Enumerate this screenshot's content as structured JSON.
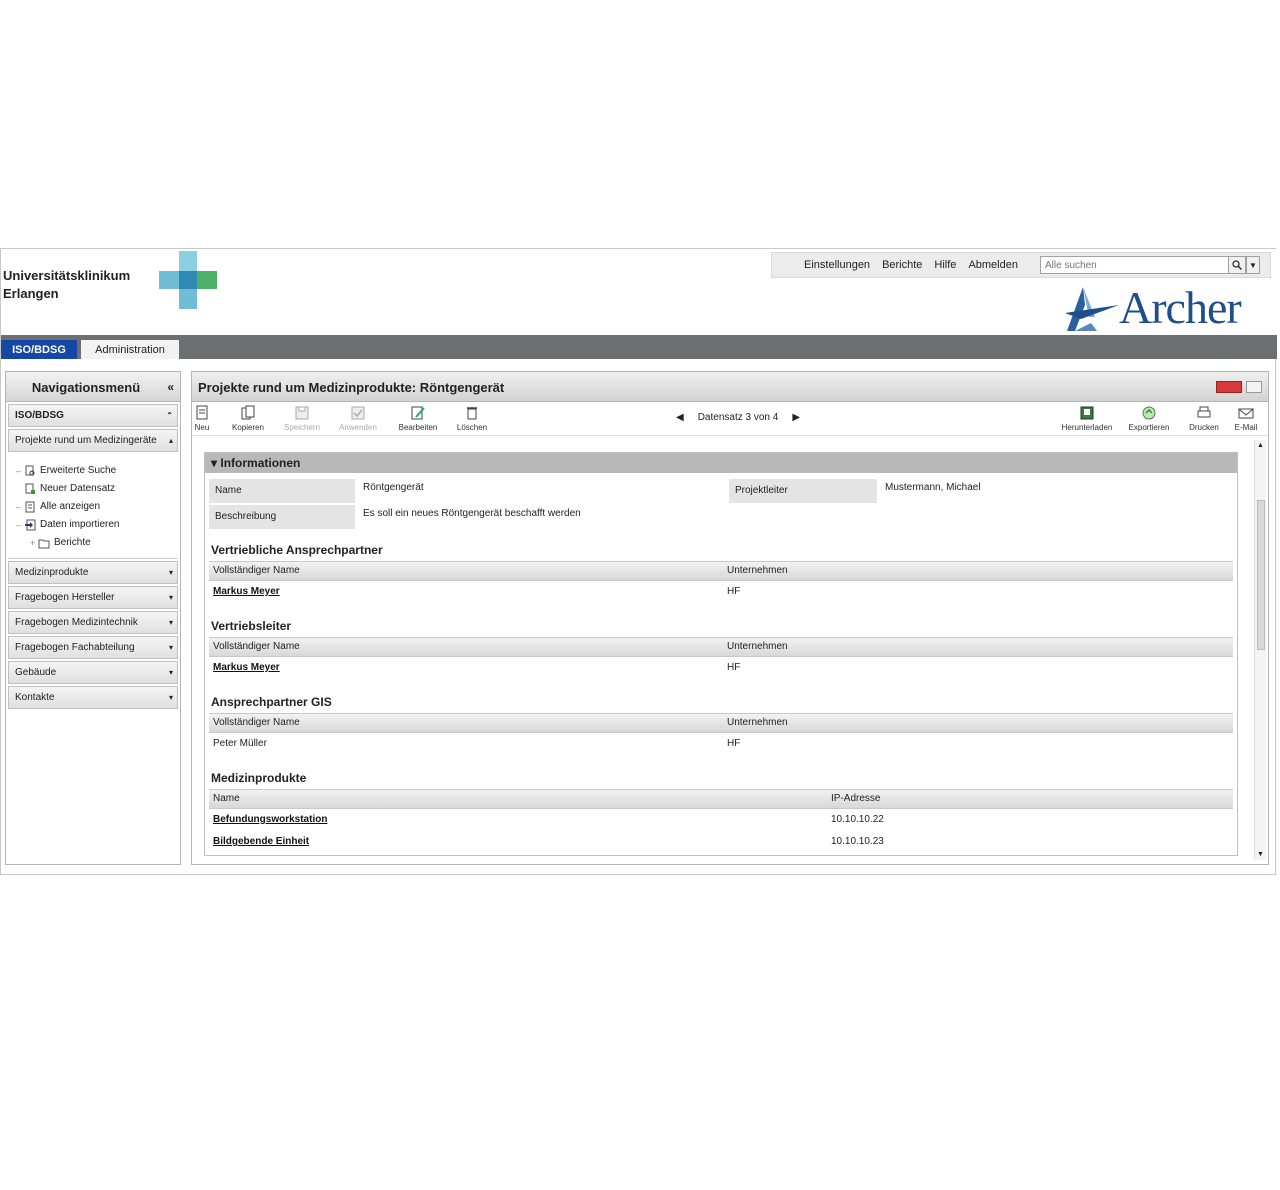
{
  "header": {
    "org_line1": "Universitätsklinikum",
    "org_line2": "Erlangen",
    "menu": [
      "Einstellungen",
      "Berichte",
      "Hilfe",
      "Abmelden"
    ],
    "search_placeholder": "Alle suchen",
    "brand": "Archer"
  },
  "tabs": [
    "ISO/BDSG",
    "Administration"
  ],
  "nav": {
    "title": "Navigationsmenü",
    "collapse": "«",
    "sections_top": [
      "ISO/BDSG",
      "Projekte rund um Medizingeräte"
    ],
    "tree": [
      "Erweiterte Suche",
      "Neuer Datensatz",
      "Alle anzeigen",
      "Daten importieren",
      "Berichte"
    ],
    "sections_bottom": [
      "Medizinprodukte",
      "Fragebogen Hersteller",
      "Fragebogen Medizintechnik",
      "Fragebogen Fachabteilung",
      "Gebäude",
      "Kontakte"
    ]
  },
  "main": {
    "title": "Projekte rund um Medizinprodukte: Röntgengerät",
    "toolbar_left": [
      "Neu",
      "Kopieren",
      "Speichern",
      "Anwenden",
      "Bearbeiten",
      "Löschen"
    ],
    "record_nav": "Datensatz 3 von 4",
    "toolbar_right": [
      "Herunterladen",
      "Exportieren",
      "Drucken",
      "E-Mail"
    ],
    "info": {
      "header": "Informationen",
      "name_label": "Name",
      "name_value": "Röntgengerät",
      "leader_label": "Projektleiter",
      "leader_value": "Mustermann, Michael",
      "desc_label": "Beschreibung",
      "desc_value": "Es soll ein neues Röntgengerät beschafft werden"
    },
    "vertrieb": {
      "title": "Vertriebliche Ansprechpartner",
      "col1": "Vollständiger Name",
      "col2": "Unternehmen",
      "row_name": "Markus Meyer",
      "row_company": "HF"
    },
    "vertriebsleiter": {
      "title": "Vertriebsleiter",
      "col1": "Vollständiger Name",
      "col2": "Unternehmen",
      "row_name": "Markus Meyer",
      "row_company": "HF"
    },
    "gis": {
      "title": "Ansprechpartner GIS",
      "col1": "Vollständiger Name",
      "col2": "Unternehmen",
      "row_name": "Peter Müller",
      "row_company": "HF"
    },
    "medizinprodukte": {
      "title": "Medizinprodukte",
      "col1": "Name",
      "col2": "IP-Adresse",
      "rows": [
        {
          "name": "Befundungsworkstation",
          "ip": "10.10.10.22"
        },
        {
          "name": "Bildgebende Einheit",
          "ip": "10.10.10.23"
        }
      ]
    }
  }
}
